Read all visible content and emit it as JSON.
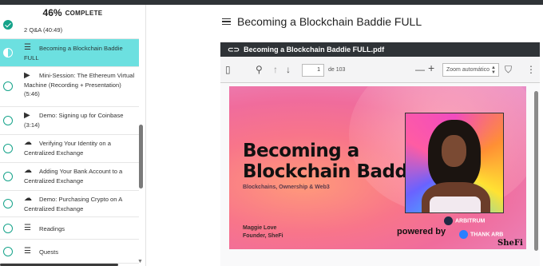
{
  "sidebar": {
    "progress_percent": "46%",
    "progress_label": "COMPLETE",
    "lessons": [
      {
        "title": "2 Q&A (40:49)",
        "icon": "none",
        "status": "done"
      },
      {
        "title": "Becoming a Blockchain Baddie FULL",
        "icon": "list-icon",
        "status": "current",
        "active": true
      },
      {
        "title": "Mini-Session: The Ethereum Virtual Machine (Recording + Presentation) (5:46)",
        "icon": "video-icon",
        "status": "todo"
      },
      {
        "title": "Demo: Signing up for Coinbase (3:14)",
        "icon": "video-icon",
        "status": "todo"
      },
      {
        "title": "Verifying Your Identity on a Centralized Exchange",
        "icon": "cloud-download-icon",
        "status": "todo"
      },
      {
        "title": "Adding Your Bank Account to a Centralized Exchange",
        "icon": "cloud-download-icon",
        "status": "todo"
      },
      {
        "title": "Demo: Purchasing Crypto on A Centralized Exchange",
        "icon": "cloud-download-icon",
        "status": "todo"
      },
      {
        "title": "Readings",
        "icon": "list-icon",
        "status": "todo"
      },
      {
        "title": "Quests",
        "icon": "list-icon",
        "status": "todo"
      }
    ]
  },
  "main": {
    "title": "Becoming a Blockchain Baddie FULL"
  },
  "viewer": {
    "filename": "Becoming a Blockchain Baddie FULL.pdf",
    "page_number": "1",
    "page_count": "de 103",
    "zoom": "Zoom automático"
  },
  "slide": {
    "title_line1": "Becoming a",
    "title_line2": "Blockchain Baddie",
    "subtitle": "Blockchains, Ownership & Web3",
    "author_name": "Maggie Love",
    "author_role": "Founder, SheFi",
    "powered_by": "powered by",
    "sponsor1": "ARBITRUM",
    "sponsor2": "THANK ARB",
    "sponsor3": "SheFi"
  },
  "colors": {
    "accent": "#16a38a",
    "active_row": "#6ce0e0",
    "viewer_header": "#2f3337"
  }
}
